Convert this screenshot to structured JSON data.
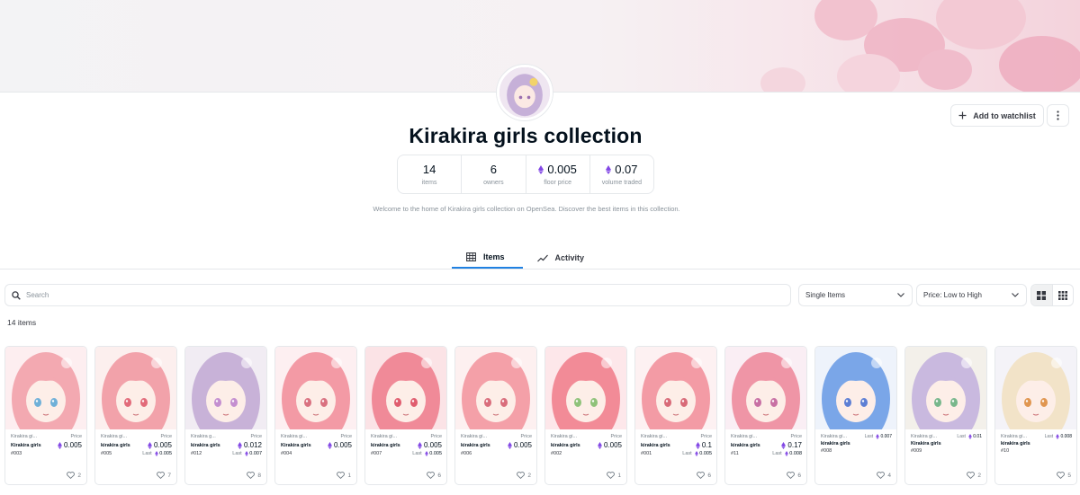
{
  "collection": {
    "title": "Kirakira girls collection",
    "description": "Welcome to the home of Kirakira girls collection on OpenSea. Discover the best items in this collection."
  },
  "header": {
    "watchlist_label": "Add to watchlist"
  },
  "stats": [
    {
      "value": "14",
      "label": "items",
      "eth": false
    },
    {
      "value": "6",
      "label": "owners",
      "eth": false
    },
    {
      "value": "0.005",
      "label": "floor price",
      "eth": true
    },
    {
      "value": "0.07",
      "label": "volume traded",
      "eth": true
    }
  ],
  "tabs": [
    {
      "label": "Items",
      "active": true
    },
    {
      "label": "Activity",
      "active": false
    }
  ],
  "filters": {
    "search_placeholder": "Search",
    "type_select": "Single Items",
    "sort_select": "Price: Low to High",
    "count_label": "14 items"
  },
  "card_labels": {
    "price": "Price",
    "last": "Last"
  },
  "colors": {
    "accent": "#2081e2",
    "eth": "#8247e5",
    "text": "#04111d",
    "muted": "#8a939b",
    "border": "#e5e8eb"
  },
  "items": [
    {
      "col": "Kirakira gi...",
      "name": "Kirakira girls",
      "id": "#003",
      "price": "0.005",
      "last": "",
      "likes": "2",
      "hair": "#f3a9b1",
      "eye": "#6fb0d8",
      "bg": "#fdeef0"
    },
    {
      "col": "Kirakira gi...",
      "name": "kirakira girls",
      "id": "#005",
      "price": "0.005",
      "last": "0.005",
      "likes": "7",
      "hair": "#f2a2aa",
      "eye": "#e26b7a",
      "bg": "#fcefee"
    },
    {
      "col": "Kirakira g...",
      "name": "kirakira girls",
      "id": "#012",
      "price": "0.012",
      "last": "0.007",
      "likes": "8",
      "hair": "#c8b2d8",
      "eye": "#c48fd0",
      "bg": "#f1ecf3"
    },
    {
      "col": "Kirakira gi...",
      "name": "Kirakira girls",
      "id": "#004",
      "price": "0.005",
      "last": "",
      "likes": "1",
      "hair": "#f39aa5",
      "eye": "#d97180",
      "bg": "#fdeff1"
    },
    {
      "col": "Kirakira gi...",
      "name": "kirakira girls",
      "id": "#007",
      "price": "0.005",
      "last": "0.005",
      "likes": "6",
      "hair": "#f08a98",
      "eye": "#e05d6f",
      "bg": "#fbe3e6"
    },
    {
      "col": "Kirakira gi...",
      "name": "kirakira girls",
      "id": "#006",
      "price": "0.005",
      "last": "",
      "likes": "2",
      "hair": "#f4a0a8",
      "eye": "#d96d7c",
      "bg": "#fdf0f0"
    },
    {
      "col": "Kirakira gi...",
      "name": "kirakira girls",
      "id": "#002",
      "price": "0.005",
      "last": "",
      "likes": "1",
      "hair": "#f28b97",
      "eye": "#8fc27a",
      "bg": "#fde7ea"
    },
    {
      "col": "Kirakira gi...",
      "name": "kirakira girls",
      "id": "#001",
      "price": "0.1",
      "last": "0.005",
      "likes": "6",
      "hair": "#f39ba5",
      "eye": "#d86a78",
      "bg": "#fdf1f2"
    },
    {
      "col": "Kirakira gi...",
      "name": "kirakira girls",
      "id": "#11",
      "price": "0.17",
      "last": "0.008",
      "likes": "6",
      "hair": "#ef95a6",
      "eye": "#c870a4",
      "bg": "#faeef4"
    },
    {
      "col": "Kirakira gi...",
      "name": "kirakira girls",
      "id": "#008",
      "price": "",
      "last": "0.007",
      "likes": "4",
      "hair": "#7aa6e8",
      "eye": "#5d7fd4",
      "bg": "#eef3fb"
    },
    {
      "col": "Kirakira gi...",
      "name": "Kirakira girls",
      "id": "#009",
      "price": "",
      "last": "0.01",
      "likes": "2",
      "hair": "#c9b9df",
      "eye": "#78b78c",
      "bg": "#f3f0ea"
    },
    {
      "col": "Kirakira gi...",
      "name": "kirakira girls",
      "id": "#10",
      "price": "",
      "last": "0.008",
      "likes": "5",
      "hair": "#f2e3c8",
      "eye": "#e09650",
      "bg": "#f4f3f8"
    }
  ]
}
